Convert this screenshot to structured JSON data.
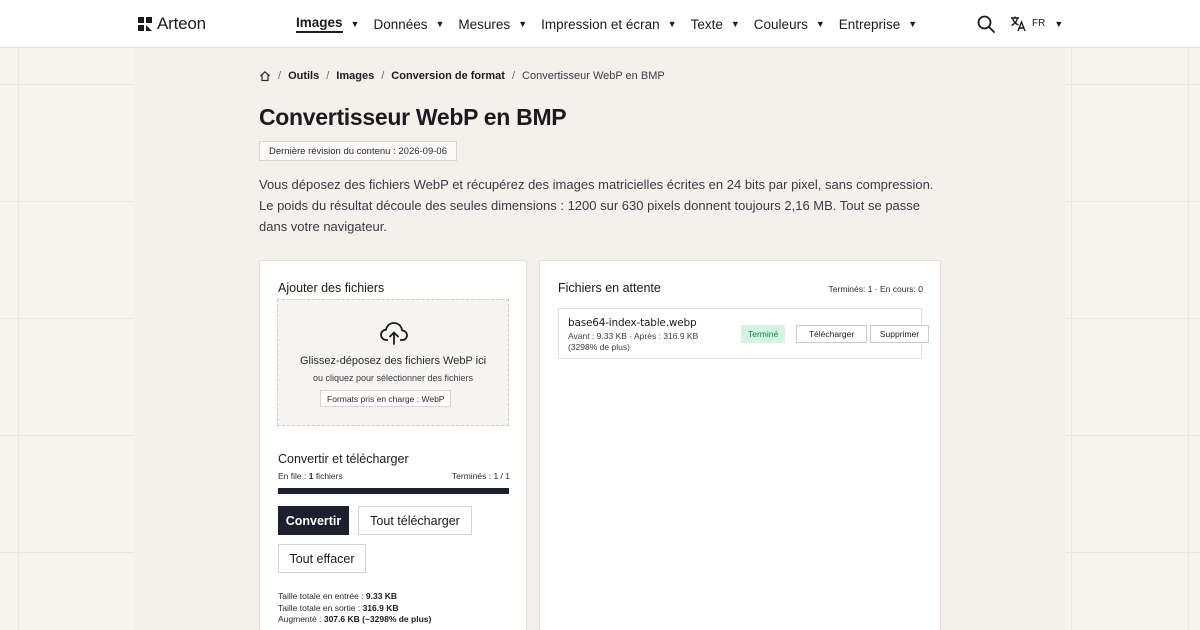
{
  "header": {
    "brand": "Arteon",
    "nav": [
      {
        "label": "Images",
        "active": true
      },
      {
        "label": "Données"
      },
      {
        "label": "Mesures"
      },
      {
        "label": "Impression et écran"
      },
      {
        "label": "Texte"
      },
      {
        "label": "Couleurs"
      },
      {
        "label": "Entreprise"
      }
    ],
    "lang": "FR",
    "icons": {
      "logo": "grid-logo-icon",
      "search": "search-icon",
      "translate": "translate-icon",
      "caret": "▼"
    }
  },
  "breadcrumb": {
    "items": [
      "Outils",
      "Images",
      "Conversion de format"
    ],
    "current": "Convertisseur WebP en BMP",
    "separator": "/"
  },
  "page": {
    "title": "Convertisseur WebP en BMP",
    "revision": "Dernière révision du contenu : 2026-09-06",
    "intro": "Vous déposez des fichiers WebP et récupérez des images matricielles écrites en 24 bits par pixel, sans compression. Le poids du résultat découle des seules dimensions : 1200 sur 630 pixels donnent toujours 2,16 MB. Tout se passe dans votre navigateur."
  },
  "upload": {
    "title": "Ajouter des fichiers",
    "drop_title": "Glissez-déposez des fichiers WebP ici",
    "drop_sub": "ou cliquez pour sélectionner des fichiers",
    "formats": "Formats pris en charge : WebP"
  },
  "convert": {
    "title": "Convertir et télécharger",
    "queue_prefix": "En file : ",
    "queue_count": "1",
    "queue_suffix": " fichiers",
    "finished": "Terminés : 1 / 1",
    "progress": 1.0,
    "convert_label": "Convertir",
    "download_all_label": "Tout télécharger",
    "clear_label": "Tout effacer",
    "total_in_label": "Taille totale en entrée : ",
    "total_in": "9.33 KB",
    "total_out_label": "Taille totale en sortie : ",
    "total_out": "316.9 KB",
    "increase_label": "Augmenté : ",
    "increase": "307.6 KB (~3298% de plus)"
  },
  "pending": {
    "title": "Fichiers en attente",
    "counts": "Terminés: 1 · En cours: 0",
    "files": [
      {
        "name": "base64-index-table.webp",
        "meta1": "Avant : 9.33 KB · Après : 316.9 KB",
        "meta2": "(3298% de plus)",
        "status": "Terminé",
        "download_label": "Télécharger",
        "delete_label": "Supprimer"
      }
    ]
  },
  "colors": {
    "accent": "#1e1f2e",
    "success_bg": "#d3f4e2",
    "success_text": "#14804a"
  }
}
